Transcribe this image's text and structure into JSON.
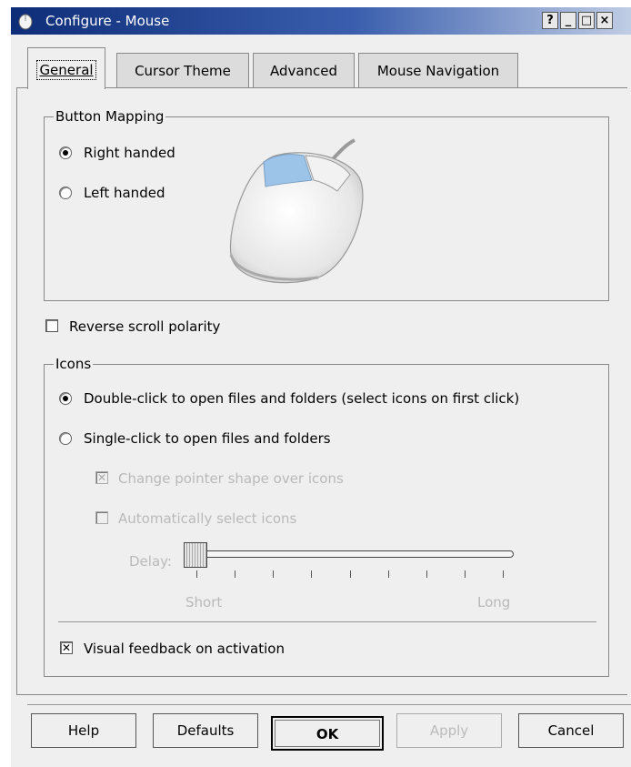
{
  "window": {
    "title": "Configure - Mouse",
    "help_btn": "?",
    "min_btn": "_",
    "max_btn": "□",
    "close_btn": "×"
  },
  "tabs": [
    {
      "label": "General",
      "mnemonic_index": 0
    },
    {
      "label": "Cursor Theme",
      "mnemonic_index": 0
    },
    {
      "label": "Advanced",
      "mnemonic_index": -1
    },
    {
      "label": "Mouse Navigation",
      "mnemonic_index": -1
    }
  ],
  "button_mapping": {
    "legend": "Button Mapping",
    "right_handed": "Right handed",
    "left_handed": "Left handed",
    "selected": "right"
  },
  "reverse_scroll": {
    "label": "Reverse scroll polarity",
    "checked": false
  },
  "icons": {
    "legend": "Icons",
    "double_click": "Double-click to open files and folders (select icons on first click)",
    "single_click": "Single-click to open files and folders",
    "selected": "double",
    "change_pointer": {
      "label": "Change pointer shape over icons",
      "checked": true,
      "enabled": false
    },
    "auto_select": {
      "label": "Automatically select icons",
      "checked": false,
      "enabled": false
    },
    "delay": {
      "label": "Delay:",
      "min_label": "Short",
      "max_label": "Long",
      "value_fraction": 0.0
    },
    "visual_feedback": {
      "label": "Visual feedback on activation",
      "checked": true
    }
  },
  "buttons": {
    "help": "Help",
    "defaults": "Defaults",
    "ok": "OK",
    "apply": "Apply",
    "cancel": "Cancel"
  },
  "colors": {
    "titlebar_start": "#0e2d79",
    "titlebar_end": "#c3d0e6",
    "mouse_button_highlight": "#9cc3e8"
  }
}
